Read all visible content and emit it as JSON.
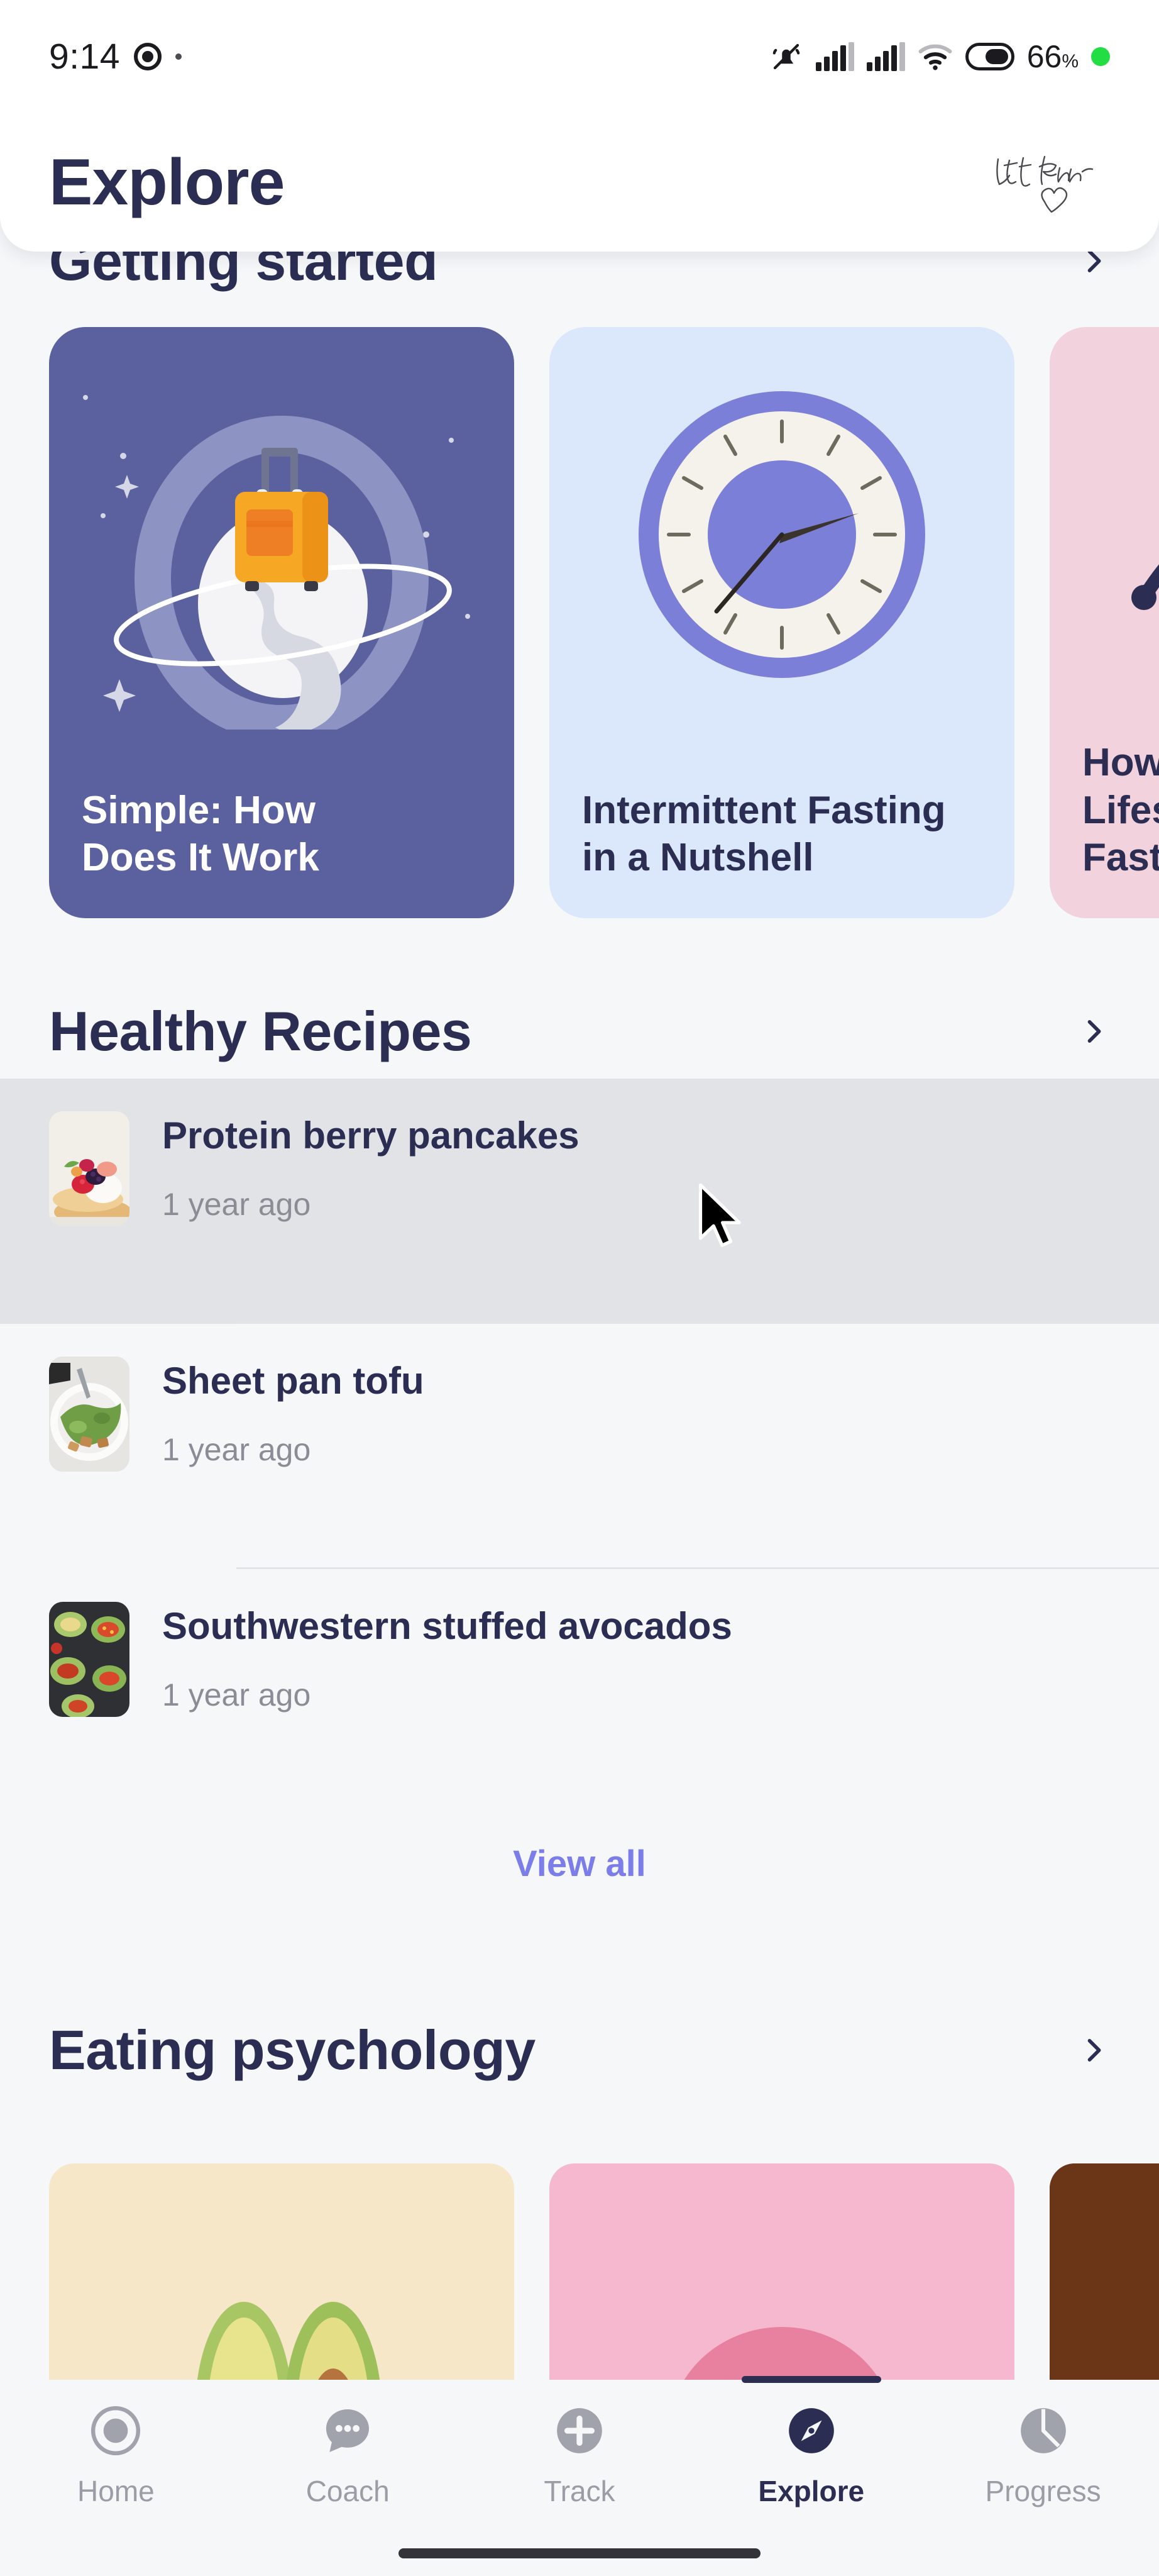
{
  "status_bar": {
    "time": "9:14",
    "battery_percent": "66",
    "percent_symbol": "%",
    "icons": [
      "camera-dot-icon",
      "silent-mode-icon",
      "signal-bars-icon",
      "signal-bars-2-icon",
      "wifi-icon",
      "battery-icon",
      "green-dot-icon"
    ]
  },
  "header": {
    "title": "Explore",
    "widget_text": "Let them",
    "widget_icon": "heart-icon"
  },
  "sections": {
    "getting_started": {
      "title": "Getting started",
      "chevron": "chevron-right-icon",
      "cards": [
        {
          "title": "Simple: How\nDoes It Work",
          "bg": "#5b619e",
          "art": "planet-suitcase-illustration"
        },
        {
          "title": "Intermittent Fasting\nin a Nutshell",
          "bg": "#dbe7fa",
          "art": "clock-illustration"
        },
        {
          "title": "How\nLifestyle Affects\nFasting",
          "bg": "#f2d2dd",
          "art": "lifestyle-illustration"
        }
      ]
    },
    "healthy_recipes": {
      "title": "Healthy Recipes",
      "chevron": "chevron-right-icon",
      "view_all": "View all",
      "items": [
        {
          "name": "Protein berry pancakes",
          "date": "1 year ago",
          "thumb": "berry-pancakes-thumbnail",
          "highlighted": true
        },
        {
          "name": "Sheet pan tofu",
          "date": "1 year ago",
          "thumb": "tofu-salad-thumbnail",
          "highlighted": false
        },
        {
          "name": "Southwestern stuffed avocados",
          "date": "1 year ago",
          "thumb": "stuffed-avocados-thumbnail",
          "highlighted": false
        }
      ]
    },
    "eating_psychology": {
      "title": "Eating psychology",
      "chevron": "chevron-right-icon",
      "cards": [
        {
          "art": "avocado-halves-photo",
          "bg": "#f6e6c8"
        },
        {
          "art": "pink-donut-photo",
          "bg": "#f4b9cd"
        },
        {
          "art": "chocolate-photo",
          "bg": "#5a2c19"
        }
      ]
    }
  },
  "bottom_nav": {
    "items": [
      {
        "label": "Home",
        "icon": "home-circle-icon",
        "active": false
      },
      {
        "label": "Coach",
        "icon": "chat-dots-icon",
        "active": false
      },
      {
        "label": "Track",
        "icon": "plus-circle-icon",
        "active": false
      },
      {
        "label": "Explore",
        "icon": "compass-icon",
        "active": true
      },
      {
        "label": "Progress",
        "icon": "pie-chart-icon",
        "active": false
      }
    ]
  },
  "colors": {
    "accent_purple": "#7b7ee8",
    "text_dark": "#2b2d52",
    "text_muted": "#8a8c96",
    "background": "#f6f7f9",
    "surface": "#ffffff",
    "row_highlight": "#e2e3e6",
    "battery_green": "#22dd44"
  }
}
